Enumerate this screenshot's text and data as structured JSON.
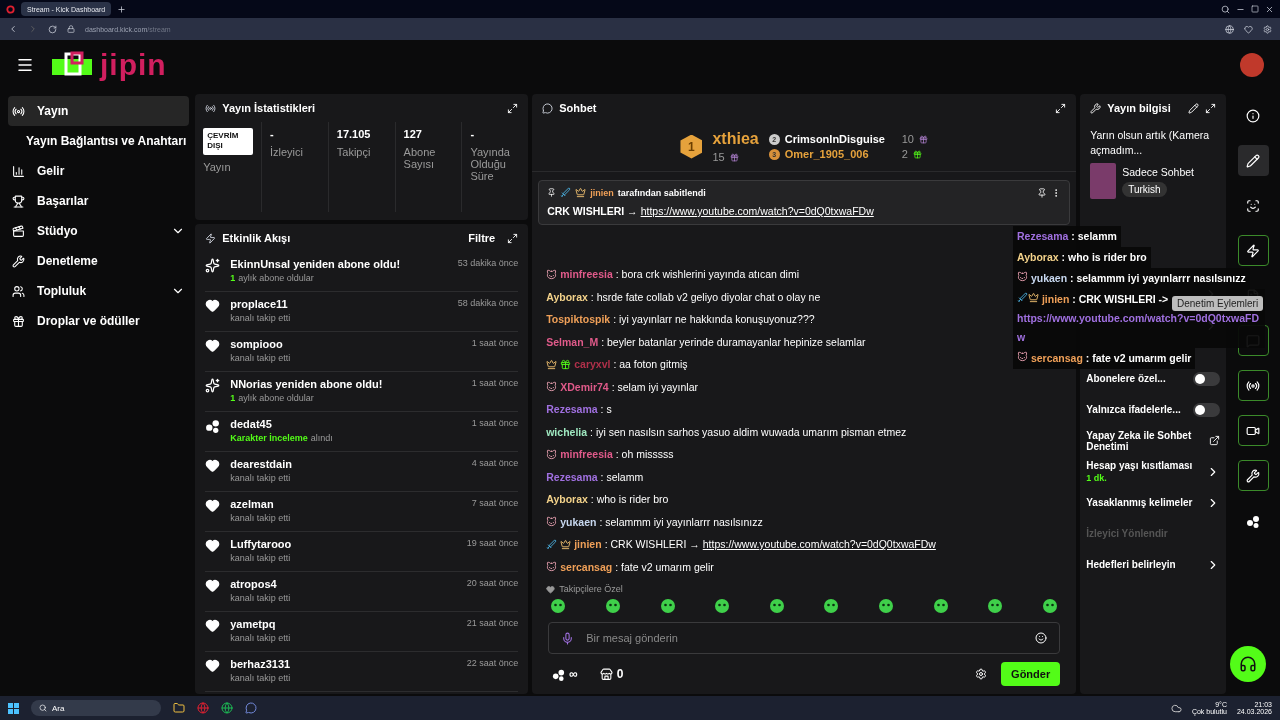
{
  "browser": {
    "tab_title": "Stream - Kick Dashboard",
    "url_host": "dashboard.kick.com",
    "url_path": "/stream"
  },
  "header": {
    "logo_text": "jipin"
  },
  "sidebar": {
    "items": [
      {
        "label": "Yayın",
        "selected": true,
        "expandable": false,
        "children": [
          {
            "label": "Yayın Bağlantısı ve Anahtarı",
            "selected": false
          }
        ]
      },
      {
        "label": "Gelir",
        "selected": false,
        "expandable": false
      },
      {
        "label": "Başarılar",
        "selected": false,
        "expandable": false
      },
      {
        "label": "Stüdyo",
        "selected": false,
        "expandable": true
      },
      {
        "label": "Denetleme",
        "selected": false,
        "expandable": false
      },
      {
        "label": "Topluluk",
        "selected": false,
        "expandable": true
      },
      {
        "label": "Droplar ve ödüller",
        "selected": false,
        "expandable": false
      }
    ]
  },
  "stats": {
    "title": "Yayın İstatistikleri",
    "status_badge": "ÇEVRİM DIŞI",
    "status_label": "Yayın",
    "items": [
      {
        "value": "-",
        "label": "İzleyici"
      },
      {
        "value": "17.105",
        "label": "Takipçi"
      },
      {
        "value": "127",
        "label": "Abone Sayısı"
      },
      {
        "value": "-",
        "label": "Yayında Olduğu Süre"
      }
    ]
  },
  "activity": {
    "title": "Etkinlik Akışı",
    "filter": "Filtre",
    "items": [
      {
        "kind": "resub",
        "title": "EkinnUnsal yeniden abone oldu!",
        "highlight": "1",
        "detail": "aylık abone oldular",
        "time": "53 dakika önce"
      },
      {
        "kind": "follow",
        "title": "proplace11",
        "detail": "kanalı takip etti",
        "time": "58 dakika önce"
      },
      {
        "kind": "follow",
        "title": "sompiooo",
        "detail": "kanalı takip etti",
        "time": "1 saat önce"
      },
      {
        "kind": "resub",
        "title": "NNorias yeniden abone oldu!",
        "highlight": "1",
        "detail": "aylık abone oldular",
        "time": "1 saat önce"
      },
      {
        "kind": "drop",
        "title": "dedat45",
        "highlight": "Karakter İnceleme",
        "detail": "alındı",
        "time": "1 saat önce"
      },
      {
        "kind": "follow",
        "title": "dearestdain",
        "detail": "kanalı takip etti",
        "time": "4 saat önce"
      },
      {
        "kind": "follow",
        "title": "azelman",
        "detail": "kanalı takip etti",
        "time": "7 saat önce"
      },
      {
        "kind": "follow",
        "title": "Luffytarooo",
        "detail": "kanalı takip etti",
        "time": "19 saat önce"
      },
      {
        "kind": "follow",
        "title": "atropos4",
        "detail": "kanalı takip etti",
        "time": "20 saat önce"
      },
      {
        "kind": "follow",
        "title": "yametpq",
        "detail": "kanalı takip etti",
        "time": "21 saat önce"
      },
      {
        "kind": "follow",
        "title": "berhaz3131",
        "detail": "kanalı takip etti",
        "time": "22 saat önce"
      }
    ]
  },
  "chat": {
    "title": "Sohbet",
    "leaderboard": [
      {
        "rank": "1",
        "user": "xthiea",
        "count": "15",
        "color": "#e6a23c"
      },
      {
        "rank": "2",
        "user": "CrimsonInDisguise",
        "count": "10",
        "color": "#ffffff"
      },
      {
        "rank": "3",
        "user": "Omer_1905_006",
        "count": "2",
        "color": "#e6a23c"
      }
    ],
    "pinned": {
      "pinned_by": "jinien",
      "pinned_note": "tarafından sabitlendi",
      "text": "CRK WISHLERI →",
      "link": "https://www.youtube.com/watch?v=0dQ0txwaFDw"
    },
    "messages": [
      {
        "kind": "mascot",
        "user": "minfreesia",
        "color": "#e05a8a",
        "text": ": bora crk wishlerini yayında atıcan dimi"
      },
      {
        "kind": "plain",
        "user": "Ayborax",
        "color": "#f3d28a",
        "text": ": hsrde fate collab v2 geliyo diyolar chat o olay ne"
      },
      {
        "kind": "plain",
        "user": "Tospiktospik",
        "color": "#f0a058",
        "text": ": iyi yayınlarr ne hakkında konuşuyonuz???"
      },
      {
        "kind": "plain",
        "user": "Selman_M",
        "color": "#e05a8a",
        "text": ": beyler batanlar yerinde duramayanlar hepinize selamlar"
      },
      {
        "kind": "crown_gift",
        "user": "caryxvl",
        "color": "#b0304a",
        "text": ": aa foton gitmiş"
      },
      {
        "kind": "mascot",
        "user": "XDemir74",
        "color": "#e05a8a",
        "text": ": selam iyi yayınlar"
      },
      {
        "kind": "plain",
        "user": "Rezesama",
        "color": "#a070e0",
        "text": ": s"
      },
      {
        "kind": "plain",
        "user": "wichelia",
        "color": "#9fe8c0",
        "text": ": iyi sen nasılsın sarhos yasuo aldim wuwada umarım pisman etmez"
      },
      {
        "kind": "mascot",
        "user": "minfreesia",
        "color": "#e05a8a",
        "text": ": oh misssss"
      },
      {
        "kind": "plain",
        "user": "Rezesama",
        "color": "#a070e0",
        "text": ": selamm"
      },
      {
        "kind": "plain",
        "user": "Ayborax",
        "color": "#f3d28a",
        "text": ": who is rider bro"
      },
      {
        "kind": "mascot",
        "user": "yukaen",
        "color": "#c8d8f0",
        "text": ": selammm iyi yayınlarrr nasılsınızz"
      },
      {
        "kind": "sword_crown",
        "user": "jinien",
        "color": "#f0a058",
        "text": ": CRK WISHLERI →",
        "link": "https://www.youtube.com/watch?v=0dQ0txwaFDw"
      },
      {
        "kind": "mascot",
        "user": "sercansag",
        "color": "#f0a058",
        "text": ": fate v2 umarım gelir"
      }
    ],
    "emote_section": "Takipçilere Özel",
    "input": {
      "placeholder": "Bir mesaj gönderin"
    },
    "points": "∞",
    "store_count": "0",
    "send": "Gönder"
  },
  "stream_info": {
    "title": "Yayın bilgisi",
    "stream_title": "Yarın olsun artık (Kamera açmadım...",
    "category": "Sadece Sohbet",
    "tag": "Turkish",
    "settings": [
      {
        "kind": "toggle",
        "label": "Abonelere özel...",
        "on": false
      },
      {
        "kind": "toggle",
        "label": "Yalnızca ifadelerle...",
        "on": false
      },
      {
        "kind": "external",
        "label": "Yapay Zeka ile Sohbet Denetimi"
      },
      {
        "kind": "nav",
        "label": "Hesap yaşı kısıtlaması",
        "sub": "1 dk."
      },
      {
        "kind": "nav",
        "label": "Yasaklanmış kelimeler"
      },
      {
        "kind": "disabled",
        "label": "İzleyici Yönlendir"
      },
      {
        "kind": "nav",
        "label": "Hedefleri belirleyin"
      }
    ]
  },
  "tooltip": "Denetim Eylemleri",
  "overlay_chat": [
    {
      "kind": "plain",
      "user": "Rezesama",
      "color": "#a070e0",
      "text": ": selamm"
    },
    {
      "kind": "plain",
      "user": "Ayborax",
      "color": "#f3d28a",
      "text": ": who is rider bro"
    },
    {
      "kind": "mascot",
      "user": "yukaen",
      "color": "#c8d8f0",
      "text": ": selammm iyi yayınlarrr nasılsınızz"
    },
    {
      "kind": "sword_crown",
      "user": "jinien",
      "color": "#f0a058",
      "text": ": CRK WISHLERI ->",
      "link": "https://www.youtube.com/watch?v=0dQ0txwaFDw"
    },
    {
      "kind": "mascot",
      "user": "sercansag",
      "color": "#f0a058",
      "text": ": fate v2 umarım gelir"
    }
  ],
  "rail": [
    {
      "selected": false
    },
    {
      "selected": true
    },
    {
      "selected": false
    },
    {
      "selected": true
    },
    {
      "selected": false
    },
    {
      "selected": true
    },
    {
      "selected": true
    },
    {
      "selected": true
    },
    {
      "selected": true
    },
    {
      "selected": false
    }
  ],
  "taskbar": {
    "search": "Ara",
    "weather_temp": "9°C",
    "weather_text": "Çok bulutlu",
    "time": "21:03",
    "date": "24.03.2026"
  }
}
